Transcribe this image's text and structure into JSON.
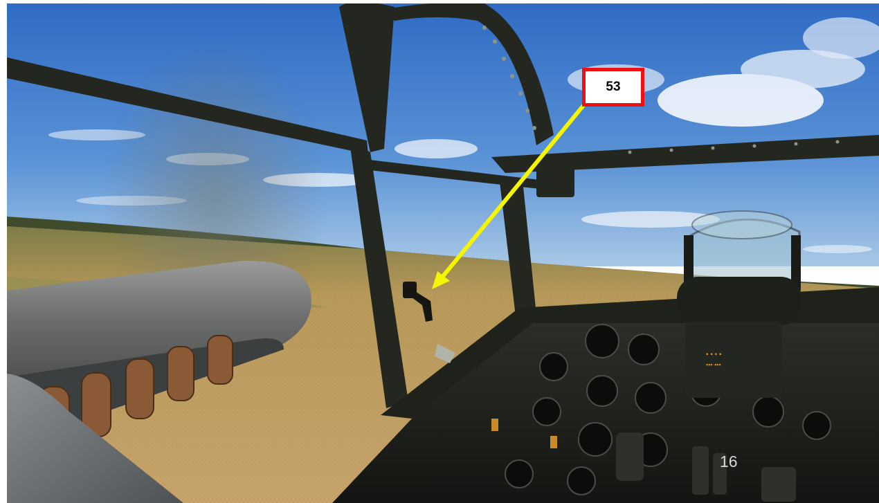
{
  "slide": {
    "callout": {
      "number": "53",
      "border_color": "#ee1111"
    },
    "arrow_color": "#f5f500",
    "page_number": "16"
  },
  "scene": {
    "subject": "cockpit-view-bomber",
    "elements": [
      "sky",
      "clouds",
      "airfield-grass",
      "engine-nacelle",
      "propeller-blur",
      "canopy-frame",
      "instrument-panel",
      "gunsight",
      "window-latch"
    ]
  }
}
